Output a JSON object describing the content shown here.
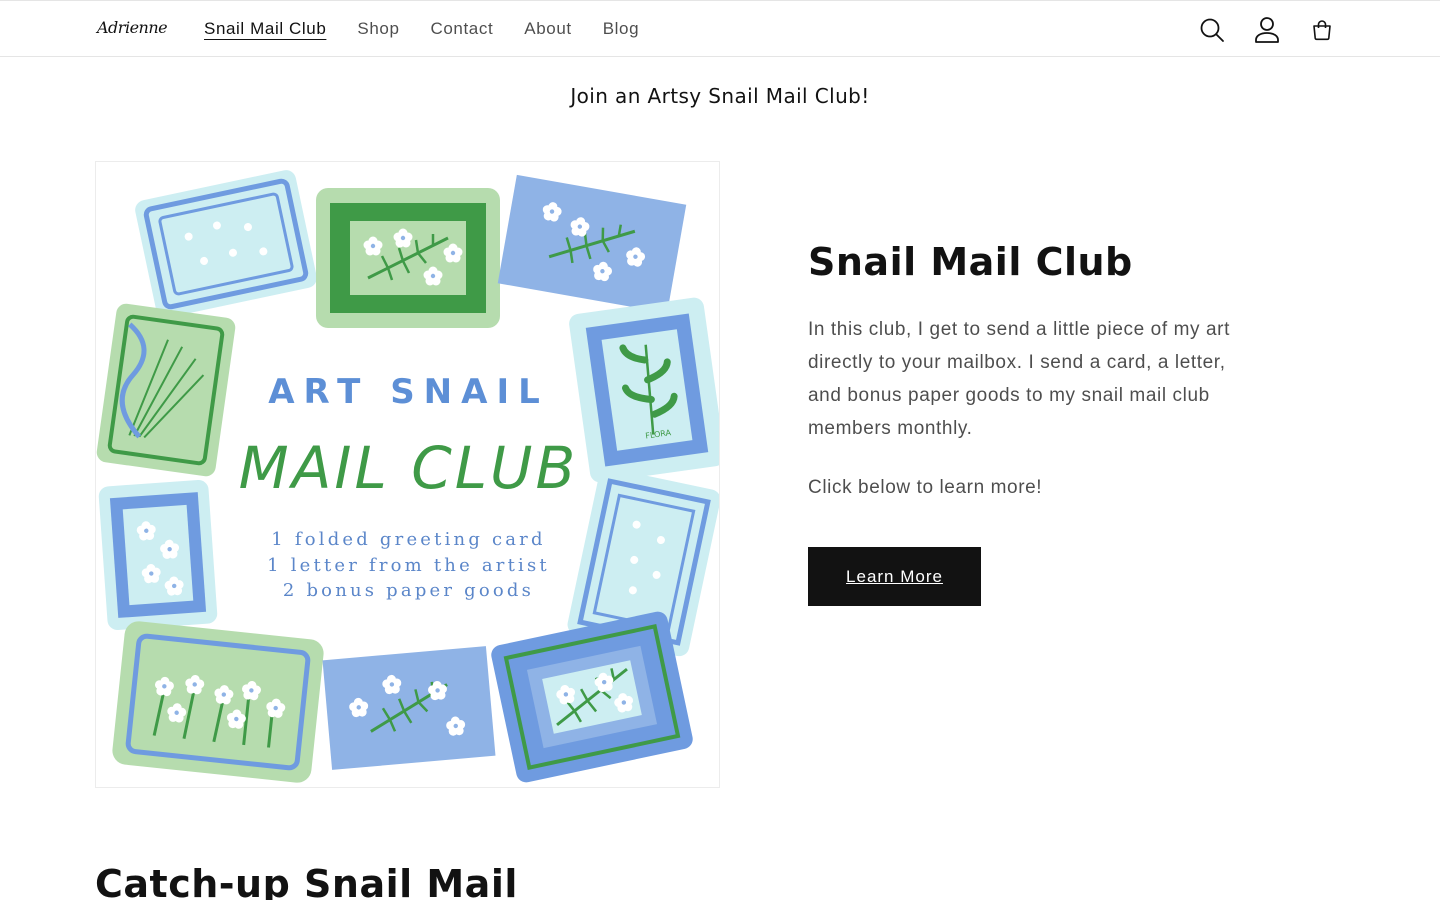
{
  "header": {
    "logo_text": "Adrienne",
    "nav": [
      {
        "label": "Snail Mail Club",
        "active": true
      },
      {
        "label": "Shop"
      },
      {
        "label": "Contact"
      },
      {
        "label": "About"
      },
      {
        "label": "Blog"
      }
    ],
    "icons": [
      "search-icon",
      "account-icon",
      "cart-icon"
    ]
  },
  "banner": {
    "text": "Join an Artsy Snail Mail Club!"
  },
  "feature": {
    "image": {
      "line1": "ART SNAIL",
      "line2": "MAIL CLUB",
      "line3": "1 folded greeting card",
      "line4": "1 letter from the artist",
      "line5": "2 bonus paper goods",
      "stamp_label": "FLORA"
    },
    "title": "Snail Mail Club",
    "description": "In this club, I get to send a little piece of my art directly to your mailbox. I send a card, a letter, and bonus paper goods to my snail mail club members monthly.",
    "cta_text": "Click below to learn more!",
    "button_label": "Learn More"
  },
  "next_section": {
    "title": "Catch-up Snail Mail"
  },
  "colors": {
    "stamp_green": "#3f9a47",
    "stamp_light_green": "#b6dcae",
    "stamp_blue": "#6f9be0",
    "stamp_light_blue": "#cdeef2",
    "button_bg": "#121212"
  }
}
